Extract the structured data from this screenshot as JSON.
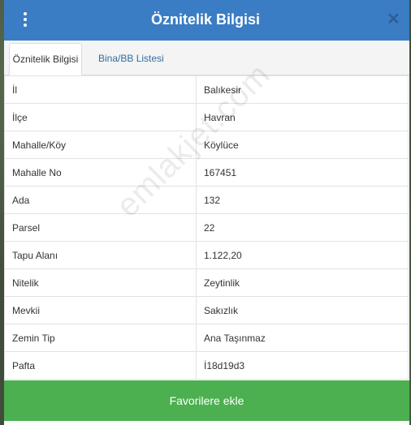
{
  "header": {
    "title": "Öznitelik Bilgisi"
  },
  "tabs": [
    {
      "label": "Öznitelik Bilgisi",
      "active": true
    },
    {
      "label": "Bina/BB Listesi",
      "active": false
    }
  ],
  "attributes": [
    {
      "key": "İl",
      "value": "Balıkesir"
    },
    {
      "key": "İlçe",
      "value": "Havran"
    },
    {
      "key": "Mahalle/Köy",
      "value": "Köylüce"
    },
    {
      "key": "Mahalle No",
      "value": "167451"
    },
    {
      "key": "Ada",
      "value": "132"
    },
    {
      "key": "Parsel",
      "value": "22"
    },
    {
      "key": "Tapu Alanı",
      "value": "1.122,20"
    },
    {
      "key": "Nitelik",
      "value": "Zeytinlik"
    },
    {
      "key": "Mevkii",
      "value": "Sakızlık"
    },
    {
      "key": "Zemin Tip",
      "value": "Ana Taşınmaz"
    },
    {
      "key": "Pafta",
      "value": "İ18d19d3"
    }
  ],
  "watermark": "emlakjet.com",
  "footer": {
    "button_label": "Favorilere ekle"
  },
  "colors": {
    "header": "#3b7dc4",
    "footer": "#4caf50",
    "tab_link": "#2e6da4"
  },
  "icons": {
    "menu": "kebab-menu-icon",
    "close": "close-icon"
  }
}
